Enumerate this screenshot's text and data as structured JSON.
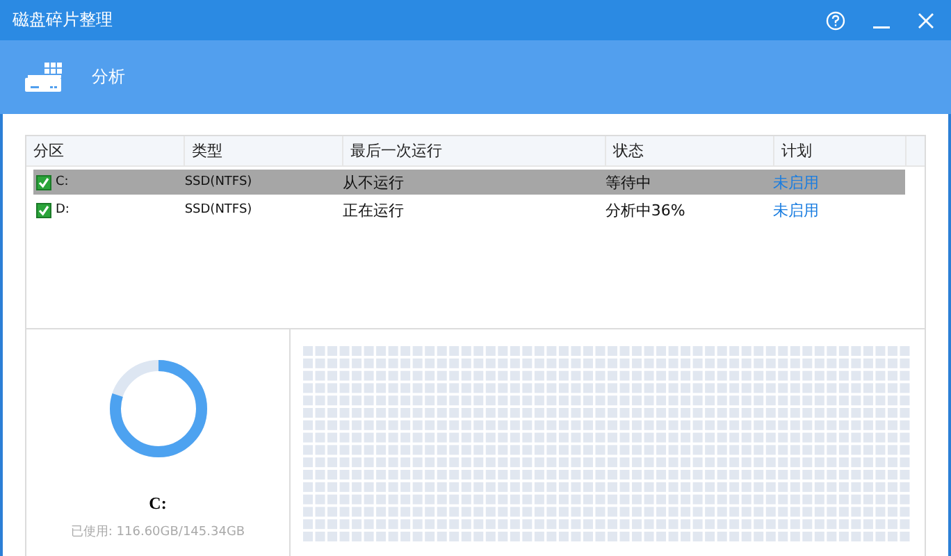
{
  "window": {
    "title": "磁盘碎片整理"
  },
  "toolbar": {
    "items": [
      {
        "label": "分析"
      }
    ]
  },
  "table": {
    "columns": [
      "分区",
      "类型",
      "最后一次运行",
      "状态",
      "计划"
    ],
    "rows": [
      {
        "selected": true,
        "checked": true,
        "cells": [
          "C:",
          "SSD(NTFS)",
          "从不运行",
          "等待中",
          "未启用"
        ]
      },
      {
        "selected": false,
        "checked": true,
        "cells": [
          "D:",
          "SSD(NTFS)",
          "正在运行",
          "分析中36%",
          "未启用"
        ]
      }
    ]
  },
  "disk": {
    "level": 0.8,
    "name": "C:",
    "usage": "已使用: 116.60GB/145.34GB"
  }
}
